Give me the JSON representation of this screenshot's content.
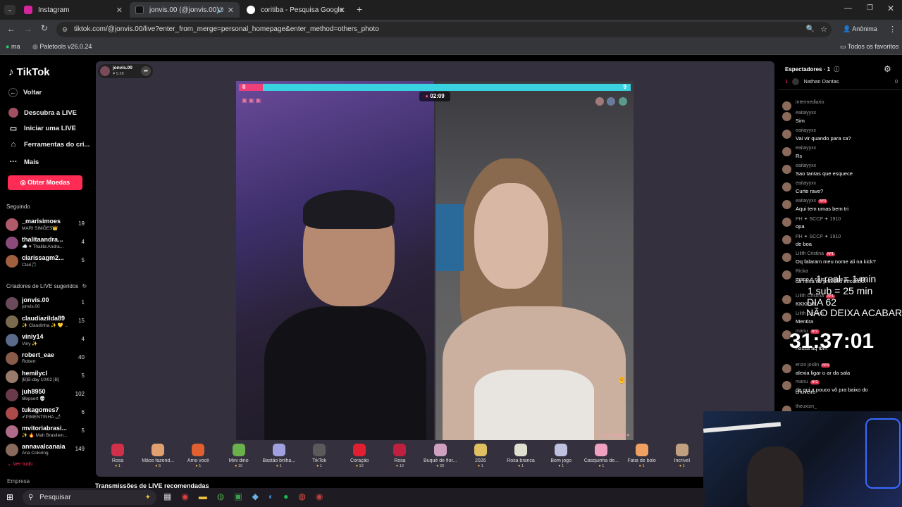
{
  "browser": {
    "tabs": [
      {
        "title": "Instagram",
        "color": "#d6249f"
      },
      {
        "title": "jonvis.00 (@jonvis.00) come",
        "color": "#111111"
      },
      {
        "title": "coritiba - Pesquisa Google",
        "color": "#4285f4"
      }
    ],
    "url": "tiktok.com/@jonvis.00/live?enter_from_merge=personal_homepage&enter_method=others_photo",
    "profile_label": "Anônima",
    "bookmarks": [
      "ma",
      "Paletools v26.0.24"
    ],
    "all_bookmarks": "Todos os favoritos"
  },
  "sidebar": {
    "logo": "TikTok",
    "back": "Voltar",
    "nav": [
      "Descubra a LIVE",
      "Iniciar uma LIVE",
      "Ferramentas do cri...",
      "Mais"
    ],
    "coins_button": "Obter Moedas",
    "following_header": "Seguindo",
    "following": [
      {
        "name": "_marisimoes",
        "sub": "MARI SIMÕES👑",
        "count": "19",
        "color": "#b05a6a"
      },
      {
        "name": "thalitaandra...",
        "sub": "☁️ ♥ Thalita Andra...",
        "count": "4",
        "color": "#8a4a7a"
      },
      {
        "name": "clarissagm2...",
        "sub": "Clari🎵",
        "count": "5",
        "color": "#a06040"
      }
    ],
    "suggested_header": "Criadores de LIVE sugeridos",
    "suggested": [
      {
        "name": "jonvis.00",
        "sub": "jonvis.00",
        "count": "1",
        "color": "#6a4a5a"
      },
      {
        "name": "claudiazilda89",
        "sub": "✨ Claudinha ✨ 💛 ...",
        "count": "15",
        "color": "#7a6a50"
      },
      {
        "name": "viniy14",
        "sub": "Viny ✨",
        "count": "4",
        "color": "#5a6a8a"
      },
      {
        "name": "robert_eae",
        "sub": "Robert",
        "count": "40",
        "color": "#8a5a4a"
      },
      {
        "name": "hemilycl",
        "sub": "[B]B-day 10/02 [B]",
        "count": "5",
        "color": "#9a7a6a"
      },
      {
        "name": "juh8950",
        "sub": "lillxpsert 💀",
        "count": "102",
        "color": "#6a3a4a"
      },
      {
        "name": "tukagomes7",
        "sub": "✔PIMENTINHA 🌶",
        "count": "6",
        "color": "#aa4a4a"
      },
      {
        "name": "mvitoriabrasi...",
        "sub": "✨ 🔥 Mah Brasilien...",
        "count": "5",
        "color": "#b06a8a"
      },
      {
        "name": "annavalcanaia",
        "sub": "Ana Coloring",
        "count": "149",
        "color": "#8a6a5a"
      }
    ],
    "see_all": "Ver tudo",
    "company": "Empresa"
  },
  "stream": {
    "host_name": "jonvis.00",
    "host_likes": "♥ 5.3K",
    "score_left": "0",
    "score_right": "9",
    "timer": "02:09",
    "right_caption": "♥ Sa Sabrina ♥"
  },
  "gifts": [
    {
      "name": "Rosa",
      "price": "1"
    },
    {
      "name": "Mãos fazend...",
      "price": "5"
    },
    {
      "name": "Amo você",
      "price": "1"
    },
    {
      "name": "Mini dino",
      "price": "10"
    },
    {
      "name": "Bastão brilha...",
      "price": "1"
    },
    {
      "name": "TikTok",
      "price": "1"
    },
    {
      "name": "Coração",
      "price": "10"
    },
    {
      "name": "Rosa",
      "price": "10"
    },
    {
      "name": "Buquê de flor...",
      "price": "30"
    },
    {
      "name": "2026",
      "price": "1"
    },
    {
      "name": "Rosa branca",
      "price": "1"
    },
    {
      "name": "Bom jogo",
      "price": "1"
    },
    {
      "name": "Casquinha de...",
      "price": "1"
    },
    {
      "name": "Fatia de bolo",
      "price": "1"
    },
    {
      "name": "Incrível",
      "price": "1"
    }
  ],
  "gift_colors": [
    "#d0304a",
    "#e0a070",
    "#e06030",
    "#6ab04c",
    "#a0a0e0",
    "#5a5a5a",
    "#e02030",
    "#c02040",
    "#d0a0c0",
    "#e0c060",
    "#e0e0d0",
    "#c0c0e0",
    "#f0a0c0",
    "#f0a060",
    "#c0a080"
  ],
  "recommended_title": "Transmissões de LIVE recomendadas",
  "chat": {
    "header": "Espectadores · 1",
    "viewer_rank": "1",
    "viewer_name": "Nathan Dantas",
    "viewer_score": "0",
    "messages": [
      {
        "user": "intermediario",
        "text": ""
      },
      {
        "user": "eaitayyxx",
        "text": "Sim"
      },
      {
        "user": "eaitayyxx",
        "text": "Vai vir quando para ca?"
      },
      {
        "user": "eaitayyxx",
        "text": "Rs"
      },
      {
        "user": "eaitayyxx",
        "text": "Sao tantas que esquece"
      },
      {
        "user": "eaitayyxx",
        "text": "Curte rave?"
      },
      {
        "user": "eaitayyxx",
        "text": "Aqui tem umas bem tri",
        "badge": "Nº3"
      },
      {
        "user": "PH ✦ SCCP ✦ 1910",
        "text": "opa"
      },
      {
        "user": "PH ✦ SCCP ✦ 1910",
        "text": "de boa"
      },
      {
        "user": "Lilith Cristina",
        "text": "Oq falaram meu nome ali na kick?",
        "badge": "Nº1"
      },
      {
        "user": "Ricka",
        "text": "mano é nois ... esse p... axilar"
      },
      {
        "user": "",
        "text": "da mina no primeiro encontro?"
      },
      {
        "user": "Lilith Cristina",
        "text": "KKKKKK",
        "badge": "Nº1"
      },
      {
        "user": "Lilith Cristina",
        "text": "Mentira"
      },
      {
        "user": "manu",
        "text": "...",
        "badge": "Nº2"
      },
      {
        "user": "",
        "text": "nossa aq tbm"
      },
      {
        "user": "enzo joslin",
        "text": "alexia ligar o ar da sala",
        "badge": "Nº3"
      },
      {
        "user": "manu",
        "text": "da qui a pouco vô pra baixo do",
        "badge": "Nº2"
      },
      {
        "user": "",
        "text": "chuveiro"
      },
      {
        "user": "theuxizn_",
        "text": "..."
      }
    ]
  },
  "overlay": {
    "line1": "1 real = 1 min",
    "line2": "1 sub = 25 min",
    "line3": "DIA 62",
    "line4": "NÃO DEIXA ACABAR",
    "timer": "31:37:01"
  },
  "taskbar": {
    "search_placeholder": "Pesquisar"
  }
}
